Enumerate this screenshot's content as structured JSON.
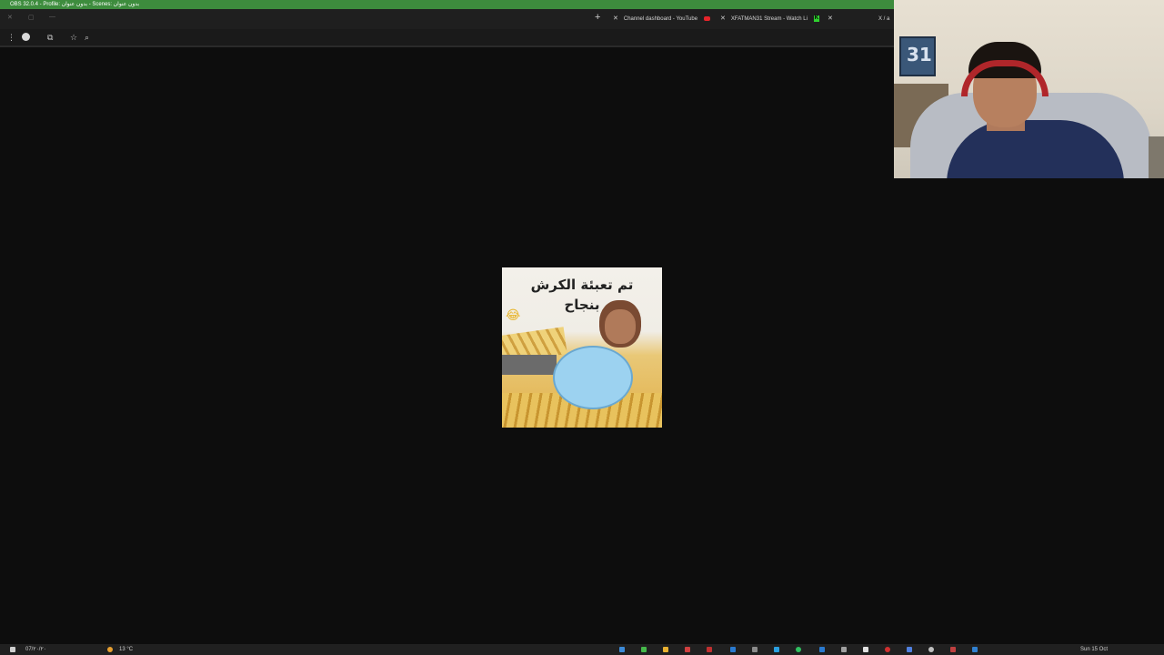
{
  "obs_title": "OBS 32.0.4 - Profile: بدون عنوان - Scenes: بدون عنوان",
  "tabs": [
    {
      "label": "Channel dashboard - YouTube",
      "favicon": "youtube-icon"
    },
    {
      "label": "XFATMAN31 Stream - Watch Li",
      "favicon": "kick-icon"
    },
    {
      "label": "X / a",
      "favicon": ""
    }
  ],
  "toolbar": {
    "icons": [
      "menu-icon",
      "profile-icon",
      "extensions-icon",
      "star-icon",
      "search-icon"
    ]
  },
  "meme": {
    "caption_line1": "تم تعبئة الكرش",
    "caption_line2": "بنجاح"
  },
  "webcam": {
    "frame_text": "31"
  },
  "taskbar": {
    "date": "07/٢٠/٢٠",
    "weather": "13 °C",
    "time_right": "Sun 15 Oct"
  },
  "colors": {
    "obs_bar": "#3d8c3d",
    "page_bg": "#0d0d0d",
    "tabstrip_bg": "#1f1f1f"
  }
}
